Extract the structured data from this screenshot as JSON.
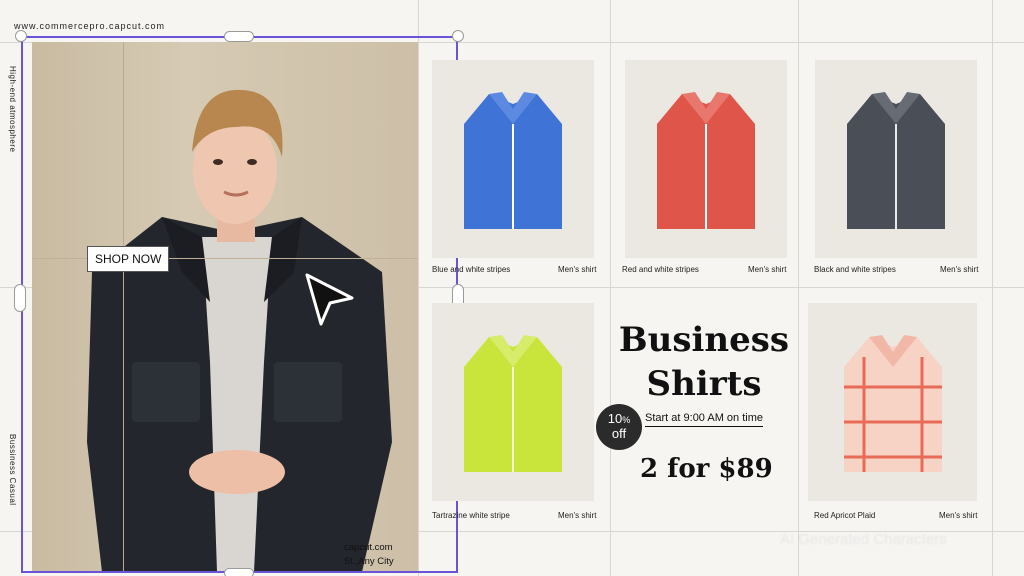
{
  "header": {
    "site_url": "www.commercepro.capcut.com"
  },
  "side_labels": {
    "top": "High-end atmosphere",
    "bottom": "Bussiness Casual"
  },
  "video": {
    "cta_label": "SHOP NOW",
    "address_line1": "capcut.com",
    "address_line2": "St.,Any City"
  },
  "products": [
    {
      "name": "Blue and white stripes",
      "type": "Men's shirt",
      "color": "#3f73d6",
      "stripe": "#ffffff"
    },
    {
      "name": "Red and white stripes",
      "type": "Men's shirt",
      "color": "#e0554a",
      "stripe": "#ffffff"
    },
    {
      "name": "Black and white stripes",
      "type": "Men's shirt",
      "color": "#4a4f57",
      "stripe": "#e9e9e9"
    },
    {
      "name": "Tartrazine white stripe",
      "type": "Men's shirt",
      "color": "#c9e43a",
      "stripe": "#f6ffd0"
    },
    {
      "name": "Red Apricot Plaid",
      "type": "Men's shirt",
      "color": "#f7d3c6",
      "stripe": "#e86b57"
    }
  ],
  "promo": {
    "title_line1": "Business",
    "title_line2": "Shirts",
    "discount_value": "10",
    "discount_unit": "%",
    "discount_word": "off",
    "start_text": "Start at 9:00 AM on time",
    "price": "2  for $89"
  },
  "watermark": "AI Generated Characters",
  "colors": {
    "selection": "#6a53d6",
    "background": "#f7f5f1"
  }
}
